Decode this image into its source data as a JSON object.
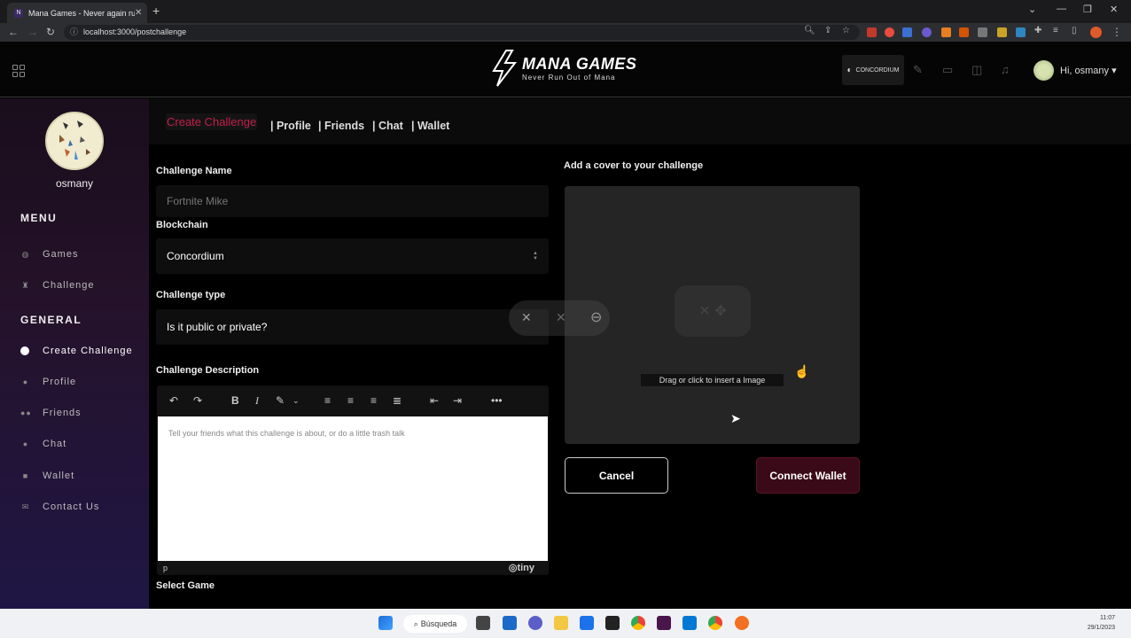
{
  "browser": {
    "tab_title": "Mana Games - Never again run o",
    "url": "localhost:3000/postchallenge"
  },
  "header": {
    "logo_main": "MANA GAMES",
    "logo_sub": "Never Run Out of Mana",
    "concordium_label": "CONCORDIUM",
    "greeting": "Hi, osmany"
  },
  "sidebar": {
    "username": "osmany",
    "menu_title": "MENU",
    "menu_items": [
      {
        "label": "Games",
        "icon": "gamepad-icon"
      },
      {
        "label": "Challenge",
        "icon": "trophy-icon"
      }
    ],
    "general_title": "GENERAL",
    "general_items": [
      {
        "label": "Create Challenge",
        "icon": "dot-icon"
      },
      {
        "label": "Profile",
        "icon": "user-icon"
      },
      {
        "label": "Friends",
        "icon": "users-icon"
      },
      {
        "label": "Chat",
        "icon": "chat-icon"
      },
      {
        "label": "Wallet",
        "icon": "wallet-icon"
      },
      {
        "label": "Contact Us",
        "icon": "mail-icon"
      }
    ]
  },
  "topnav": {
    "create": "Create Challenge",
    "profile": "| Profile",
    "friends": "| Friends",
    "chat": "| Chat",
    "wallet": "| Wallet"
  },
  "form": {
    "challenge_name_label": "Challenge Name",
    "challenge_name_placeholder": "Fortnite Mike",
    "blockchain_label": "Blockchain",
    "blockchain_value": "Concordium",
    "type_label": "Challenge type",
    "type_value": "Is it public or private?",
    "description_label": "Challenge Description",
    "description_placeholder": "Tell your friends what this challenge is about, or do a little trash talk",
    "editor_status": "p",
    "editor_brand": "tiny",
    "select_game_label": "Select Game",
    "cover_label": "Add a cover to your challenge",
    "drop_caption": "Drag or click to insert a Image",
    "cancel": "Cancel",
    "connect_wallet": "Connect Wallet"
  },
  "taskbar": {
    "search": "Búsqueda",
    "time": "11:07",
    "date": "29/1/2023"
  },
  "colors": {
    "accent": "#c3204a",
    "connect_bg": "#3a0a18"
  }
}
